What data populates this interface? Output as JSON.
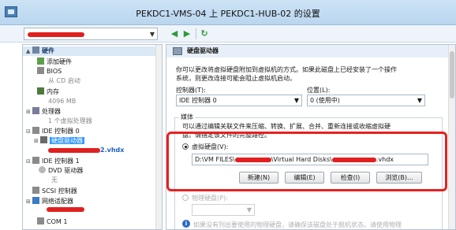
{
  "window": {
    "title": "PEKDC1-VMS-04 上 PEKDC1-HUB-02 的设置"
  },
  "toolbar": {
    "back_glyph": "◀",
    "forward_glyph": "▶",
    "refresh_glyph": "↻"
  },
  "tree": {
    "hardware_header": "硬件",
    "add_hardware": "添加硬件",
    "bios": "BIOS",
    "bios_sub": "从 CD 启动",
    "memory": "内存",
    "memory_sub": "4096 MB",
    "processor": "处理器",
    "processor_sub": "1 个虚拟处理器",
    "ide0": "IDE 控制器 0",
    "hard_drive": "硬盘驱动器",
    "hard_drive_file_suffix": "2.vhdx",
    "ide1": "IDE 控制器 1",
    "dvd": "DVD 驱动器",
    "dvd_sub": "无",
    "scsi": "SCSI 控制器",
    "network": "网络适配器",
    "com1": "COM 1"
  },
  "panel": {
    "section_title": "硬盘驱动器",
    "intro_line1": "你可以更改将虚拟硬盘附加到虚拟机的方式。如果此磁盘上已经安装了一个操作",
    "intro_line2": "系统，则更改连接可能会阻止虚拟机启动。",
    "controller_label": "控制器(T):",
    "controller_value": "IDE 控制器 0",
    "location_label": "位置(L):",
    "location_value": "0 (使用中)",
    "media_label": "媒体",
    "media_desc_line1": "可以通过编辑关联文件来压缩、转换、扩展、合并、重新连接或收缩虚拟硬",
    "media_desc_line2": "盘。请指定该文件的完整路径。",
    "vhd_radio_label": "虚拟硬盘(V):",
    "vhd_path_prefix": "D:\\VM FILES\\",
    "vhd_path_mid": "\\Virtual Hard Disks\\",
    "vhd_path_suffix": ".vhdx",
    "btn_new": "新建(N)",
    "btn_edit": "编辑(E)",
    "btn_inspect": "检查(I)",
    "btn_browse": "浏览(B)...",
    "physical_radio_label": "物理硬盘(P):",
    "note_text": "如果没有列出要使用的物理硬盘，请确保该磁盘处于脱机状态。请使用物理"
  },
  "colors": {
    "redaction": "#e02020",
    "highlight_box": "#e82020",
    "selection": "#3399ff"
  }
}
